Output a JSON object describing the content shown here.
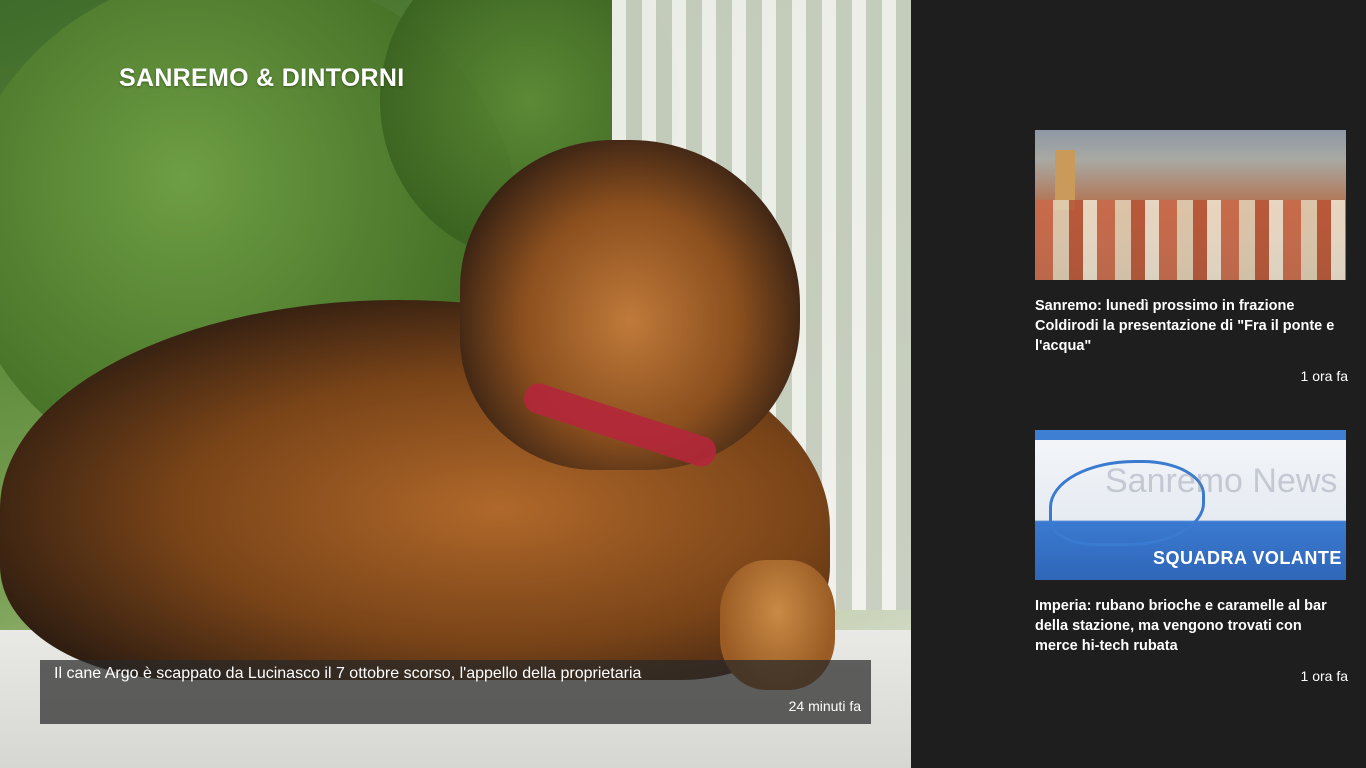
{
  "section": {
    "title": "SANREMO & DINTORNI"
  },
  "hero": {
    "headline": "Il cane Argo è scappato da Lucinasco il 7 ottobre scorso, l'appello della proprietaria",
    "time": "24 minuti fa"
  },
  "articles": [
    {
      "headline": "Sanremo: lunedì prossimo in frazione Coldirodi la presentazione di \"Fra il ponte e l'acqua\"",
      "time": "1 ora fa"
    },
    {
      "headline": "Imperia: rubano brioche e caramelle al bar della stazione, ma vengono trovati con merce hi-tech rubata",
      "time": "1 ora fa",
      "image_text": "SQUADRA VOLANTE",
      "watermark": "Sanremo News"
    }
  ],
  "colors": {
    "background": "#1e1e1e",
    "caption_overlay": "rgba(40,40,40,0.72)",
    "text": "#ffffff"
  }
}
